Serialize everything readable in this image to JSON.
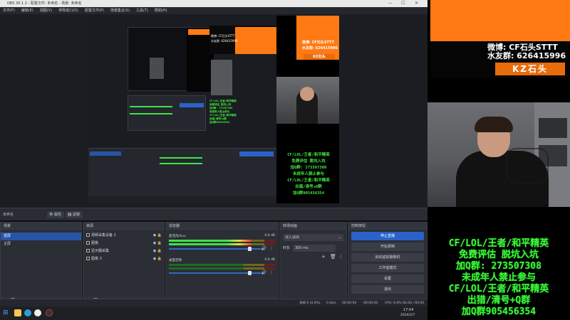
{
  "window": {
    "title": "OBS 30.1.2 - 配置文件: 未命名 - 场景: 未命名",
    "controls": [
      "—",
      "☐",
      "✕"
    ]
  },
  "menu": {
    "items": [
      "文件(F)",
      "编辑(E)",
      "视图(V)",
      "停靠窗口(D)",
      "配置文件(P)",
      "场景集合(S)",
      "工具(T)",
      "帮助(H)"
    ]
  },
  "preview": {
    "nested_weibo": "微博: CF石头STTT",
    "nested_group": "水友群: 626415996",
    "nested_brand": "KZ石头",
    "nested_promo": [
      "CF/LOL/王者/和平精英",
      "免费评估  脱坑入坑",
      "加Q群: 273507308",
      "未成年人禁止参与",
      "CF/LOL/王者/和平精英",
      "出猎/清号+Q群",
      "加Q群905456354"
    ]
  },
  "scene_bar": {
    "scene_name": "未命名",
    "properties_label": "属性",
    "filters_label": "滤镜"
  },
  "scenes": {
    "title": "场景",
    "items": [
      {
        "label": "竖屏",
        "selected": true
      },
      {
        "label": "主屏",
        "selected": false
      }
    ]
  },
  "sources": {
    "title": "来源",
    "items": [
      {
        "label": "视频采集设备 2"
      },
      {
        "label": "图像"
      },
      {
        "label": "显示器采集"
      },
      {
        "label": "图像 3"
      }
    ]
  },
  "mixer": {
    "title": "混音器",
    "tracks": [
      {
        "name": "麦克风/Aux",
        "db": "0.0 dB",
        "level": 0.78,
        "volume": 0.85
      },
      {
        "name": "桌面音频",
        "db": "0.0 dB",
        "level": 0.0,
        "volume": 0.85
      }
    ]
  },
  "transitions": {
    "title": "转场动画",
    "type": "淡入淡出",
    "duration_label": "时长",
    "duration_value": "300 ms"
  },
  "controls": {
    "title": "控制按钮",
    "buttons": [
      "停止直播",
      "开始录制",
      "启动虚拟摄像机",
      "工作室模式",
      "设置",
      "退出"
    ]
  },
  "status": {
    "dropped": "丢帧 0 (0.0%)",
    "bitrate": "0 kb/s",
    "live_time": "00:00:00",
    "rec_time": "00:00:00",
    "cpu": "CPU: 6.0%",
    "fps": "60.00 / 60.00 FPS"
  },
  "taskbar": {
    "time": "17:54",
    "date": "2024/2/7"
  },
  "overlay": {
    "weibo": "微博:  CF石头STTT",
    "group": "水友群:  626415996",
    "brand": "KZ石头",
    "promo_lines": [
      "CF/LOL/王者/和平精英",
      "免费评估  脱坑入坑",
      "加Q群: 273507308",
      "未成年人禁止参与",
      "CF/LOL/王者/和平精英",
      "出猎/清号+Q群",
      "加Q群905456354"
    ]
  },
  "colors": {
    "accent_orange": "#ff7a13",
    "promo_green": "#41ee3f",
    "selection_blue": "#2854a7"
  }
}
